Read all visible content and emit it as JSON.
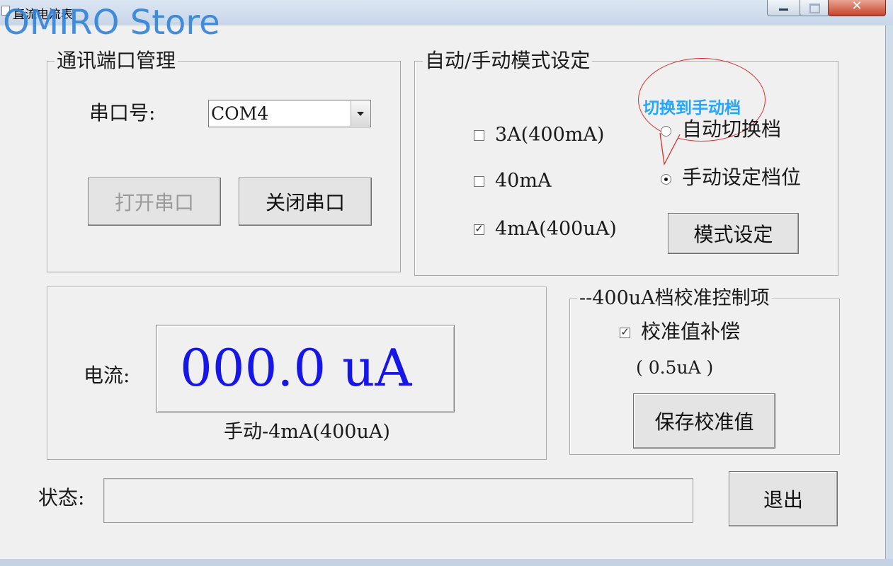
{
  "window": {
    "title": "直流电流表",
    "watermark": "OMIRO Store",
    "close_glyph": "✕"
  },
  "port_group": {
    "legend": "通讯端口管理",
    "port_label": "串口号:",
    "port_value": "COM4",
    "open_button": "打开串口",
    "close_button": "关闭串口"
  },
  "mode_group": {
    "legend": "自动/手动模式设定",
    "ranges": [
      {
        "label": "3A(400mA)",
        "checked": false
      },
      {
        "label": "40mA",
        "checked": false
      },
      {
        "label": "4mA(400uA)",
        "checked": true
      }
    ],
    "callout": "切换到手动档",
    "auto_radio": "自动切换档",
    "manual_radio": "手动设定档位",
    "selected_mode": "manual",
    "set_button": "模式设定",
    "check_mark": "✓"
  },
  "reading": {
    "label": "电流:",
    "value": "000.0  uA",
    "mode_text": "手动-4mA(400uA)"
  },
  "calibration": {
    "legend": "--400uA档校准控制项",
    "compensate_label": "校准值补偿",
    "compensate_checked": true,
    "offset": "( 0.5uA )",
    "save_button": "保存校准值"
  },
  "status": {
    "label": "状态:",
    "value": ""
  },
  "exit_button": "退出",
  "colors": {
    "display_text": "#1616e8",
    "callout_text": "#23a6ff",
    "callout_outline": "#dc2d2d",
    "watermark": "#3082d7"
  }
}
